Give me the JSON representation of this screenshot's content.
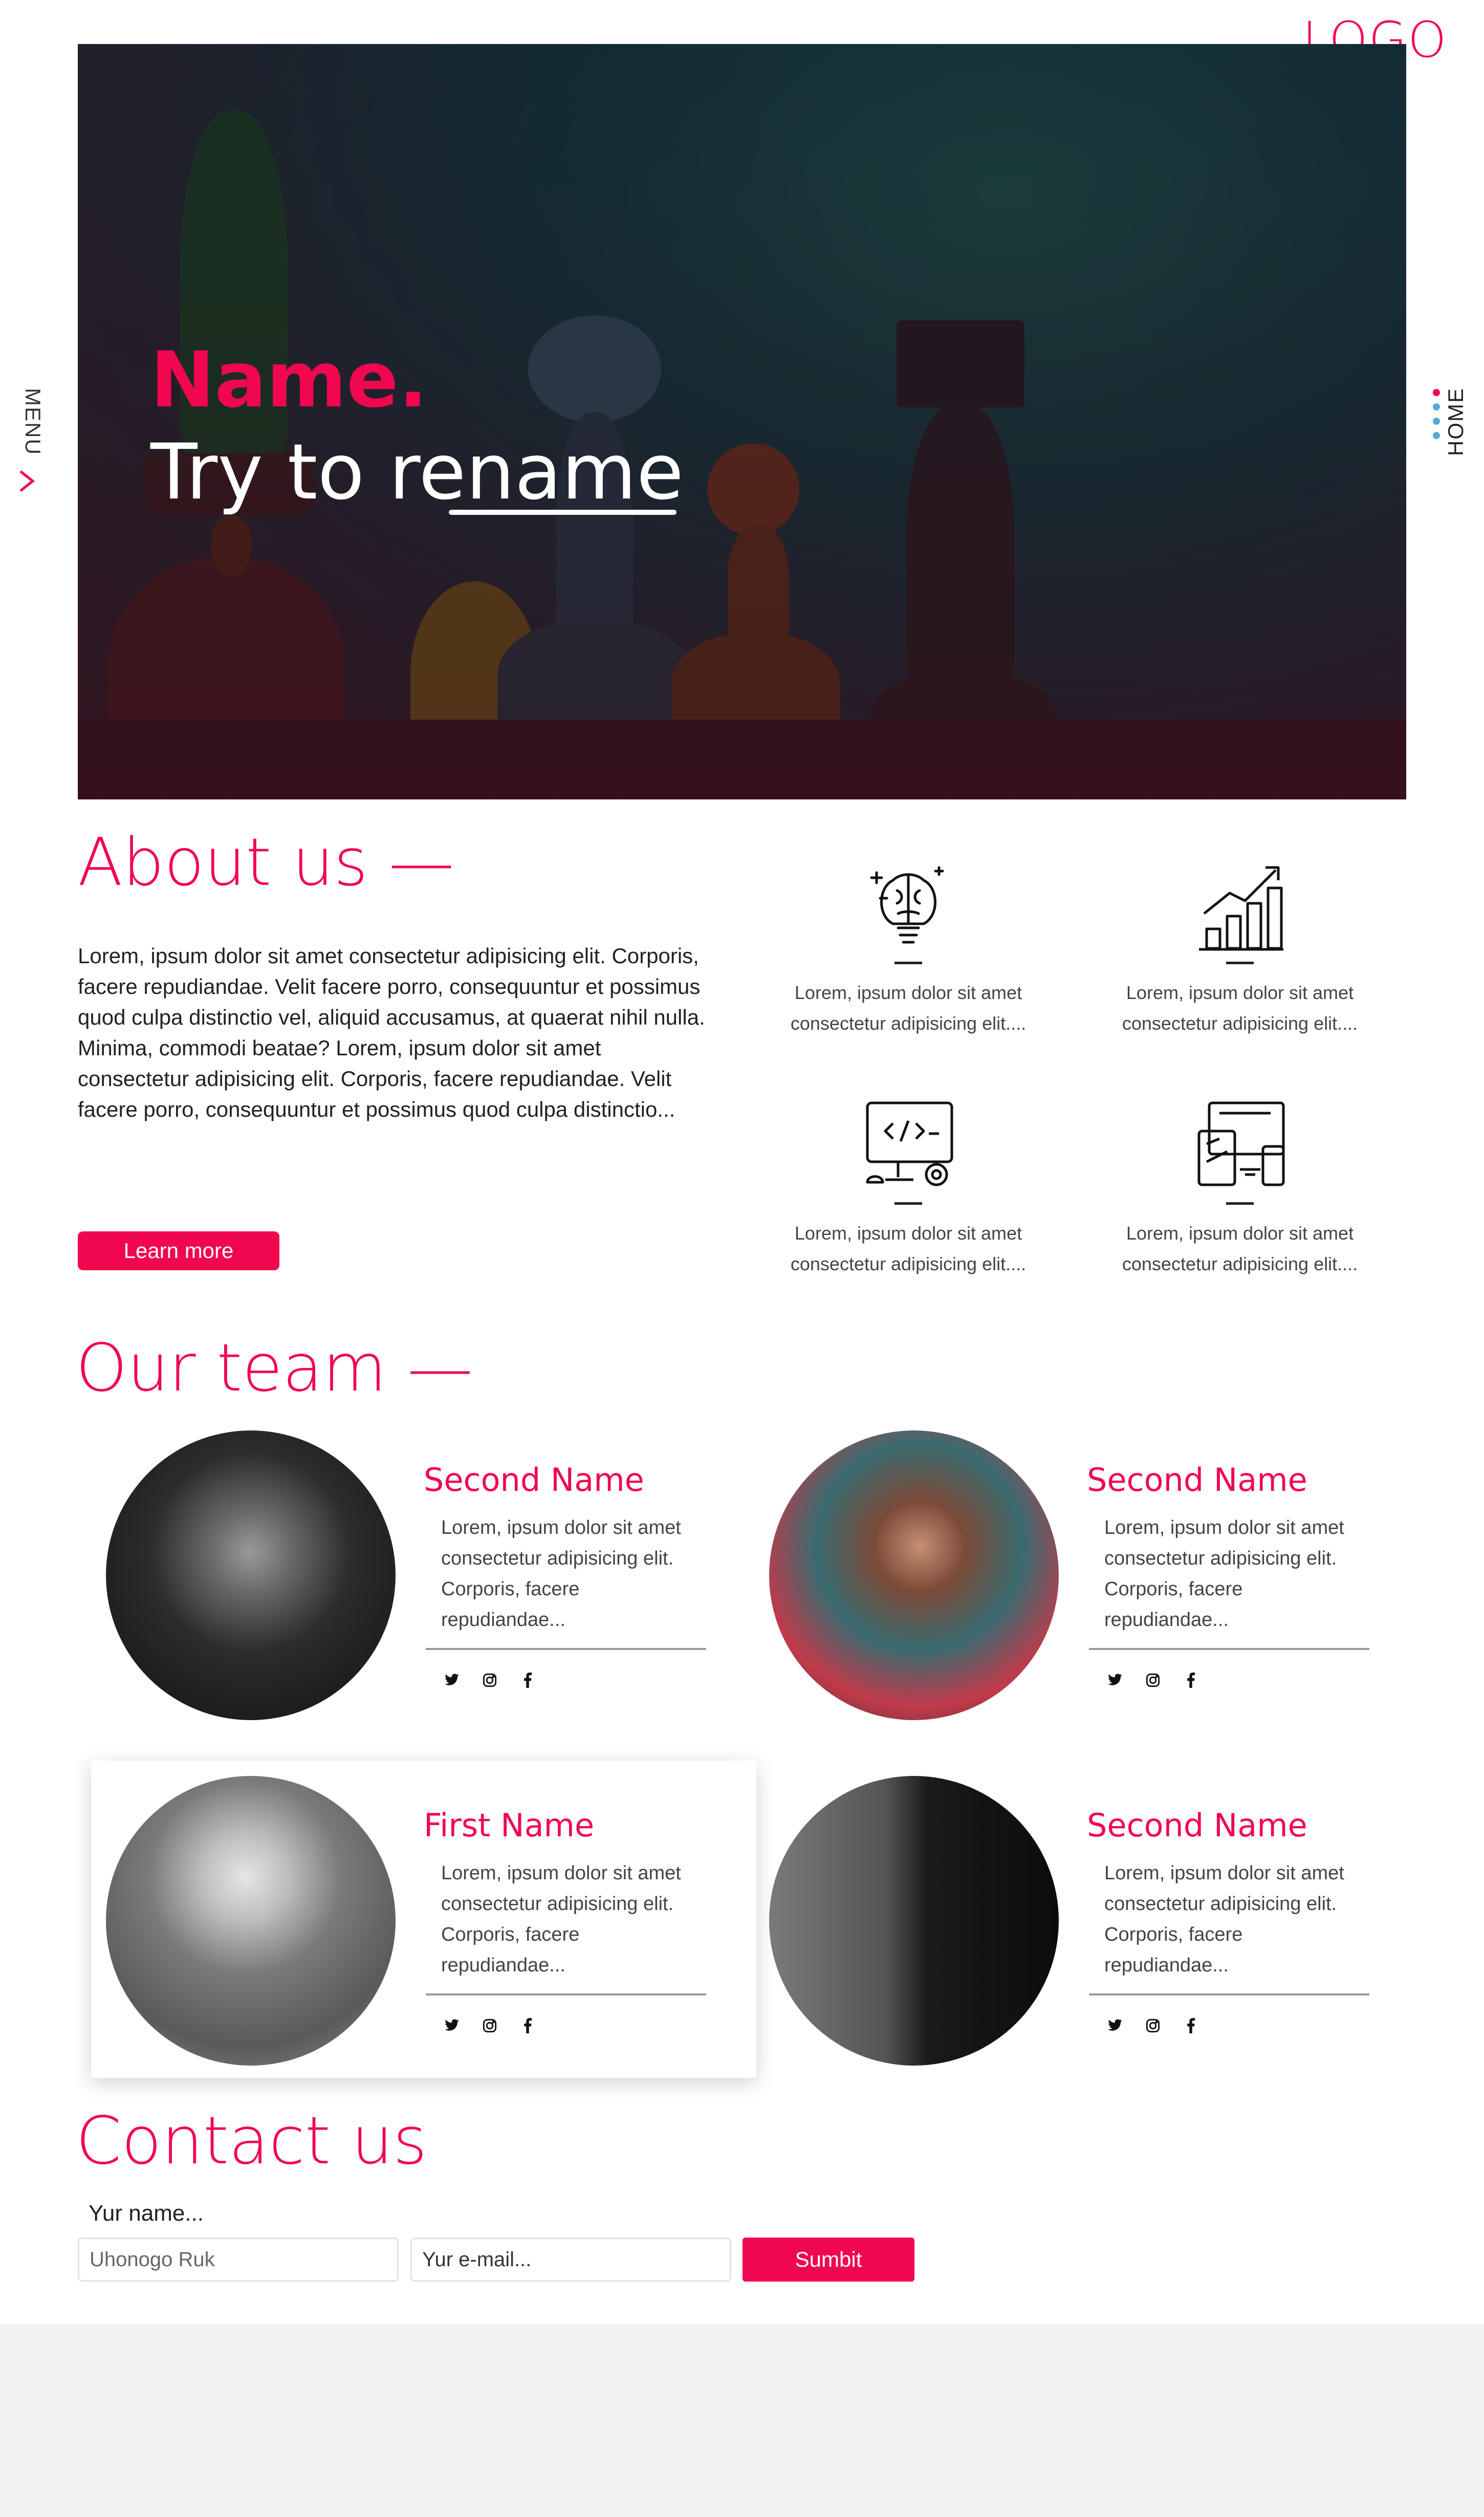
{
  "header": {
    "logo": "LOGO",
    "menu_label": "MENU",
    "home_label": "HOME",
    "dot_colors": [
      "#f0074f",
      "#5aa7d8",
      "#5aa7d8",
      "#5aa7d8"
    ]
  },
  "hero": {
    "title_line1": "Name.",
    "title_line2": "Try to rename"
  },
  "about": {
    "heading": "About us —",
    "paragraph": "Lorem, ipsum dolor sit amet consectetur adipisicing elit. Corporis, facere repudiandae. Velit facere porro, consequuntur et possimus quod culpa distinctio vel, aliquid accusamus, at quaerat nihil nulla. Minima, commodi beatae? Lorem, ipsum dolor sit amet consectetur adipisicing elit. Corporis, facere repudiandae. Velit facere porro, consequuntur et possimus quod culpa distinctio...",
    "button_label": "Learn more",
    "features": [
      {
        "icon": "brain-bulb-icon",
        "text": "Lorem, ipsum dolor sit amet consectetur adipisicing elit...."
      },
      {
        "icon": "growth-chart-icon",
        "text": "Lorem, ipsum dolor sit amet consectetur adipisicing elit...."
      },
      {
        "icon": "code-monitor-icon",
        "text": "Lorem, ipsum dolor sit amet consectetur adipisicing elit...."
      },
      {
        "icon": "devices-icon",
        "text": "Lorem, ipsum dolor sit amet consectetur adipisicing elit...."
      }
    ]
  },
  "team": {
    "heading": "Our team —",
    "members": [
      {
        "name": "Second Name",
        "bio": "Lorem, ipsum dolor sit amet consectetur adipisicing elit. Corporis, facere repudiandae..."
      },
      {
        "name": "Second Name",
        "bio": "Lorem, ipsum dolor sit amet consectetur adipisicing elit. Corporis, facere repudiandae..."
      },
      {
        "name": "First Name",
        "bio": "Lorem, ipsum dolor sit amet consectetur adipisicing elit. Corporis, facere repudiandae..."
      },
      {
        "name": "Second Name",
        "bio": "Lorem, ipsum dolor sit amet consectetur adipisicing elit. Corporis, facere repudiandae..."
      }
    ],
    "social_icons": [
      "twitter-icon",
      "instagram-icon",
      "facebook-icon"
    ]
  },
  "contact": {
    "heading": "Contact us",
    "name_label": "Yur name...",
    "name_value": "Uhonogo Ruk",
    "email_placeholder": "Yur e-mail...",
    "submit_label": "Sumbit"
  },
  "colors": {
    "accent": "#f0074f",
    "footer_bg": "#f2f2f2"
  }
}
